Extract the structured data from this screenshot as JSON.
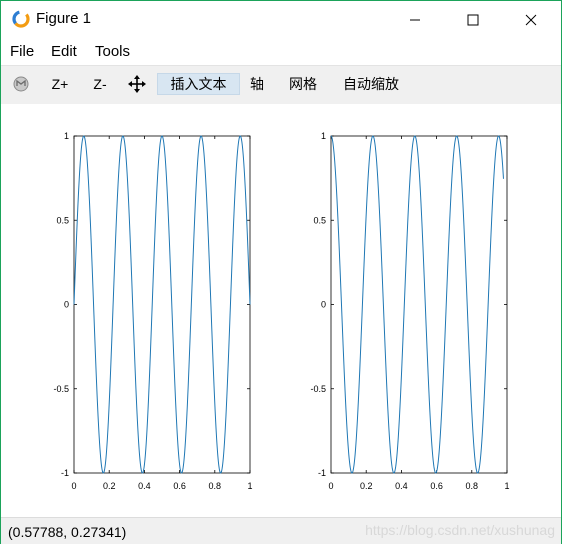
{
  "window": {
    "title": "Figure 1",
    "icon": "octave-logo-icon"
  },
  "menu": {
    "items": [
      {
        "label": "File"
      },
      {
        "label": "Edit"
      },
      {
        "label": "Tools"
      }
    ]
  },
  "toolbar": {
    "rotate_icon": "rotate-icon",
    "zoom_in": "Z+",
    "zoom_out": "Z-",
    "pan_icon": "pan-arrows-icon",
    "insert_text": "插入文本",
    "axis": "轴",
    "grid": "网格",
    "autoscale": "自动缩放"
  },
  "status": {
    "coords": "(0.57788, 0.27341)",
    "watermark": "https://blog.csdn.net/xushunag"
  },
  "colors": {
    "line": "#1f77b4",
    "window_border": "#1ba35a",
    "toolbar_bg": "#f0f0f0",
    "active_tool_bg": "#d8e6f2"
  },
  "chart_data": [
    {
      "type": "line",
      "title": "",
      "xlabel": "",
      "ylabel": "",
      "xlim": [
        0,
        1
      ],
      "ylim": [
        -1,
        1
      ],
      "xticks": [
        "0",
        "0.2",
        "0.4",
        "0.6",
        "0.8",
        "1"
      ],
      "yticks": [
        "-1",
        "-0.5",
        "0",
        "0.5",
        "1"
      ],
      "grid": false,
      "series": [
        {
          "function": "sin",
          "frequency_hz": 4.5,
          "x_range": [
            0,
            1
          ]
        }
      ]
    },
    {
      "type": "line",
      "title": "",
      "xlabel": "",
      "ylabel": "",
      "xlim": [
        0,
        1
      ],
      "ylim": [
        -1,
        1
      ],
      "xticks": [
        "0",
        "0.2",
        "0.4",
        "0.6",
        "0.8",
        "1"
      ],
      "yticks": [
        "-1",
        "-0.5",
        "0",
        "0.5",
        "1"
      ],
      "grid": false,
      "series": [
        {
          "function": "cos",
          "frequency_hz": 4.2,
          "x_range": [
            0,
            0.98
          ]
        }
      ]
    }
  ]
}
